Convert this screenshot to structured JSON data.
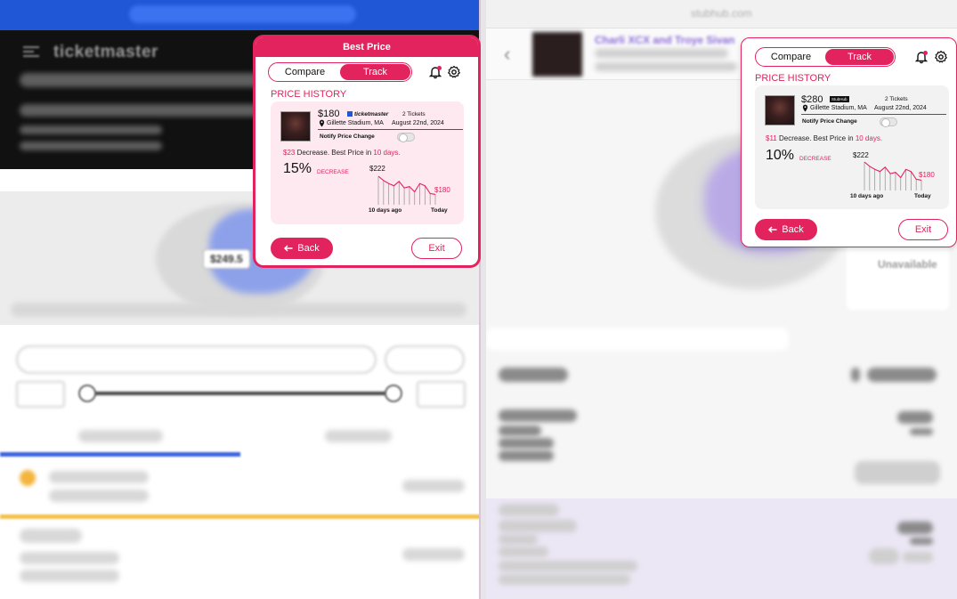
{
  "background": {
    "left_window": {
      "brand": "ticketmaster",
      "map_price_tag": "$249.5"
    },
    "right_window": {
      "url": "stubhub.com",
      "event_title": "Charli XCX and Troye Sivan",
      "legend_unavailable": "Unavailable"
    }
  },
  "popups": [
    {
      "id": "left",
      "title": "Best Price",
      "tabs": [
        {
          "label": "Compare",
          "active": false
        },
        {
          "label": "Track",
          "active": true
        }
      ],
      "section_title": "PRICE HISTORY",
      "ticket": {
        "price": "$180",
        "source": "ticketmaster",
        "tickets_count": "2 Tickets",
        "venue": "Gillette Stadium, MA",
        "date": "August 22nd, 2024"
      },
      "notify_label": "Notify Price Change",
      "change": {
        "amount": "$23",
        "text_mid": " Decrease. Best Price in ",
        "days": "10 days."
      },
      "percent": "15%",
      "percent_label": "DECREASE",
      "spark": {
        "start_label": "$222",
        "end_label": "$180",
        "x_start": "10 days ago",
        "x_end": "Today",
        "values": [
          222,
          212,
          205,
          200,
          210,
          195,
          198,
          186,
          205,
          200,
          182,
          180
        ]
      },
      "back_label": "Back",
      "exit_label": "Exit"
    },
    {
      "id": "right",
      "tabs": [
        {
          "label": "Compare",
          "active": false
        },
        {
          "label": "Track",
          "active": true
        }
      ],
      "section_title": "PRICE HISTORY",
      "ticket": {
        "price": "$280",
        "source": "StubHub",
        "tickets_count": "2 Tickets",
        "venue": "Gillette Stadium, MA",
        "date": "August 22nd, 2024"
      },
      "notify_label": "Notify Price Change",
      "change": {
        "amount": "$11",
        "text_mid": " Decrease. Best Price in ",
        "days": "10 days."
      },
      "percent": "10%",
      "percent_label": "DECREASE",
      "spark": {
        "start_label": "$222",
        "end_label": "$180",
        "x_start": "10 days ago",
        "x_end": "Today",
        "values": [
          222,
          212,
          205,
          200,
          210,
          195,
          198,
          186,
          205,
          200,
          182,
          180
        ]
      },
      "back_label": "Back",
      "exit_label": "Exit"
    }
  ],
  "colors": {
    "accent": "#e2235e",
    "card_pink": "#fde9ef",
    "card_gray": "#f2f2f2"
  }
}
